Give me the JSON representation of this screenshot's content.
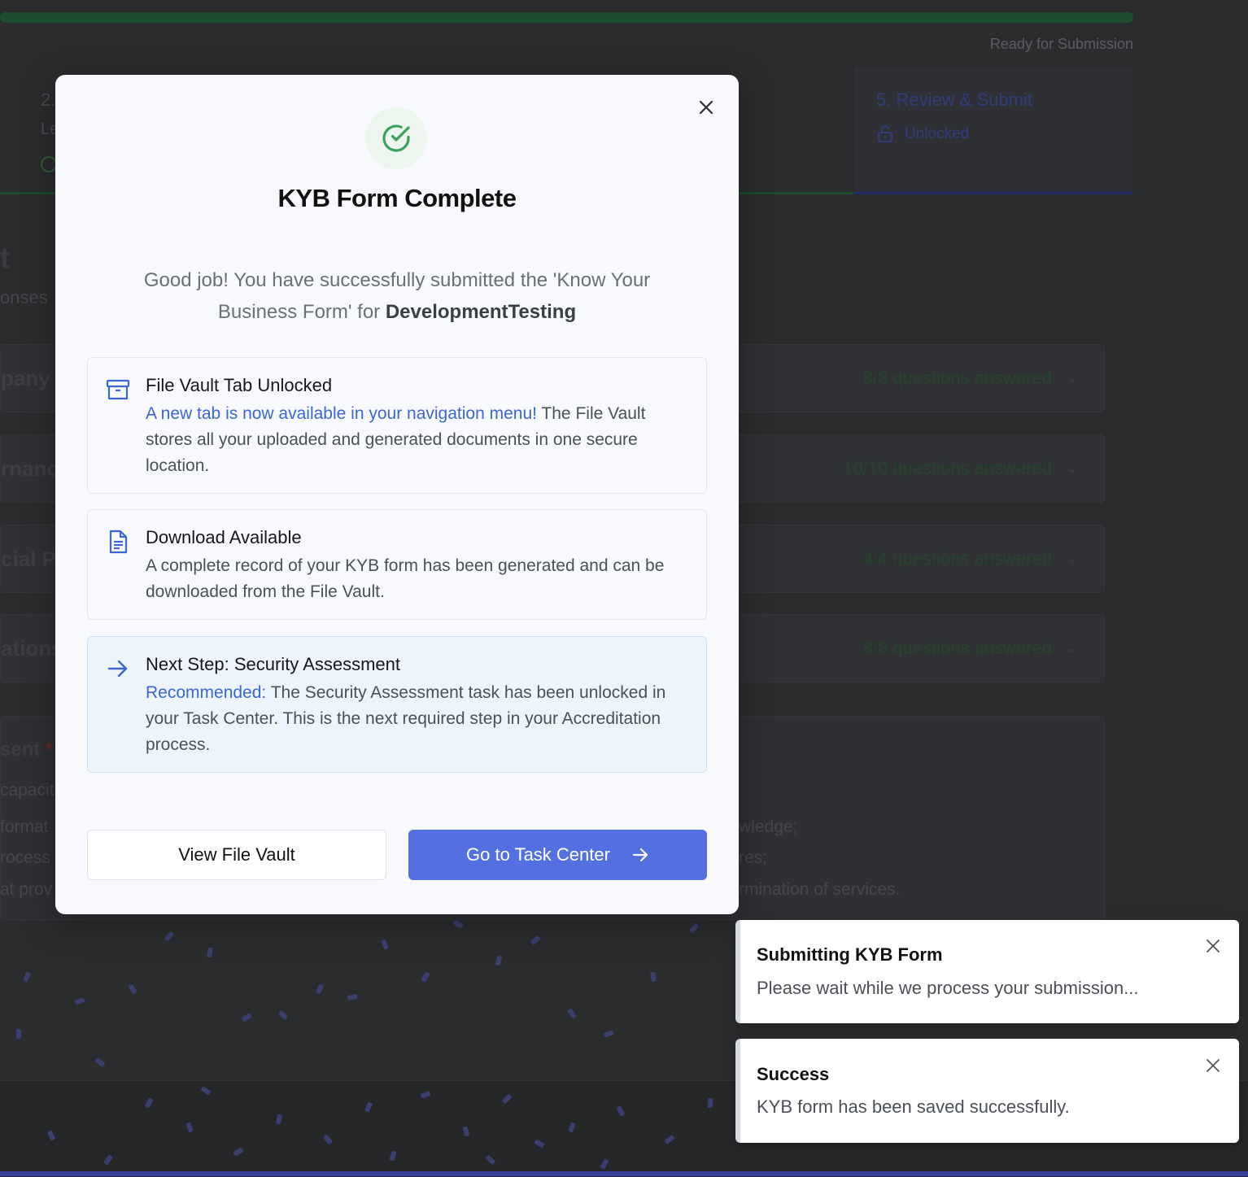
{
  "background": {
    "progress_percent": 100,
    "status_text": "Ready for Submission",
    "step_left": {
      "number": "2.",
      "subtitle": "Le"
    },
    "step5": {
      "title": "5. Review & Submit",
      "status": "Unlocked"
    },
    "heading_fragment": "t",
    "subheading_fragment": "onses",
    "sections": [
      {
        "title_fragment": "pany P",
        "count": "8/8 questions answered"
      },
      {
        "title_fragment": "rnanc",
        "count": "10/10 questions answered"
      },
      {
        "title_fragment": "cial P",
        "count": "4/4 questions answered"
      },
      {
        "title_fragment": "ations",
        "count": "8/8 questions answered"
      }
    ],
    "consent": {
      "title_fragment": "sent",
      "required_mark": "*",
      "line1": "capacit",
      "line2_left": "format",
      "line2_right": "wledge;",
      "line3_left": "rocess",
      "line3_right": "res;",
      "line4_left": "at prov",
      "line4_right": "rmination of services."
    }
  },
  "modal": {
    "title": "KYB Form Complete",
    "desc_prefix": "Good job! You have successfully submitted the 'Know Your Business Form' for ",
    "company": "DevelopmentTesting",
    "cards": [
      {
        "icon": "archive-icon",
        "title": "File Vault Tab Unlocked",
        "highlight": "A new tab is now available in your navigation menu!",
        "body": " The File Vault stores all your uploaded and generated documents in one secure location."
      },
      {
        "icon": "document-icon",
        "title": "Download Available",
        "highlight": "",
        "body": "A complete record of your KYB form has been generated and can be downloaded from the File Vault."
      },
      {
        "icon": "arrow-right-icon",
        "title": "Next Step: Security Assessment",
        "highlight": "Recommended:",
        "body": " The Security Assessment task has been unlocked in your Task Center. This is the next required step in your Accreditation process."
      }
    ],
    "buttons": {
      "secondary": "View File Vault",
      "primary": "Go to Task Center"
    }
  },
  "toasts": [
    {
      "title": "Submitting KYB Form",
      "message": "Please wait while we process your submission..."
    },
    {
      "title": "Success",
      "message": "KYB form has been saved successfully."
    }
  ],
  "colors": {
    "accent": "#5470e0",
    "link": "#3b67d3",
    "success": "#3aa15a"
  }
}
